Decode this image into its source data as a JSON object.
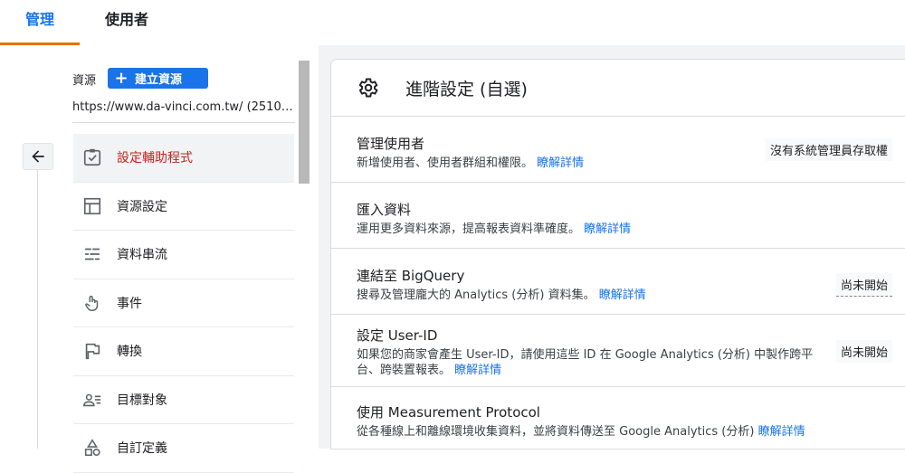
{
  "tabs": [
    {
      "label": "管理"
    },
    {
      "label": "使用者"
    }
  ],
  "property": {
    "label": "資源",
    "create_label": "建立資源",
    "url": "https://www.da-vinci.com.tw/ (2510…"
  },
  "nav": {
    "items": [
      {
        "label": "設定輔助程式",
        "icon": "checkbox-icon"
      },
      {
        "label": "資源設定",
        "icon": "layout-icon"
      },
      {
        "label": "資料串流",
        "icon": "data-stream-icon"
      },
      {
        "label": "事件",
        "icon": "touch-icon"
      },
      {
        "label": "轉換",
        "icon": "flag-icon"
      },
      {
        "label": "目標對象",
        "icon": "audience-icon"
      },
      {
        "label": "自訂定義",
        "icon": "shapes-icon"
      }
    ]
  },
  "panel": {
    "title": "進階設定 (自選)",
    "rows": [
      {
        "title": "管理使用者",
        "desc": "新增使用者、使用者群組和權限。",
        "learn": "瞭解詳情",
        "status": "沒有系統管理員存取權"
      },
      {
        "title": "匯入資料",
        "desc": "運用更多資料來源，提高報表資料準確度。",
        "learn": "瞭解詳情",
        "status": ""
      },
      {
        "title": "連結至 BigQuery",
        "desc": "搜尋及管理龐大的 Analytics (分析) 資料集。",
        "learn": "瞭解詳情",
        "status": "尚未開始"
      },
      {
        "title": "設定 User-ID",
        "desc": "如果您的商家會產生 User-ID，請使用這些 ID 在 Google Analytics (分析) 中製作跨平台、跨裝置報表。",
        "learn": "瞭解詳情",
        "status": "尚未開始"
      },
      {
        "title": "使用 Measurement Protocol",
        "desc": "從各種線上和離線環境收集資料，並將資料傳送至 Google Analytics (分析)",
        "learn": "瞭解詳情",
        "status": ""
      }
    ]
  },
  "colors": {
    "accent": "#1a73e8",
    "active_nav": "#c5221f",
    "tab_indicator": "#e37400"
  }
}
